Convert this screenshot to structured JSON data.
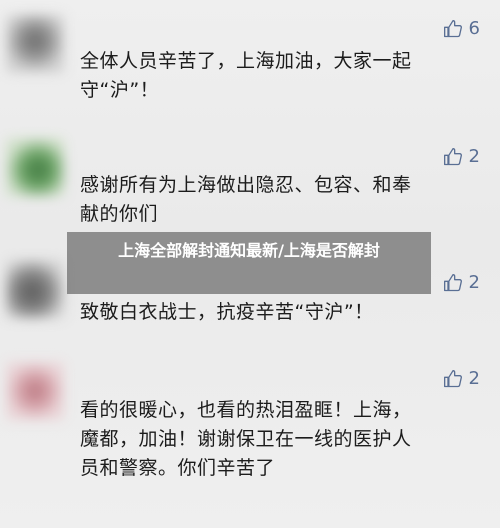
{
  "comments": [
    {
      "likes": "6",
      "text": "全体人员辛苦了，上海加油，大家一起\n守“沪”！"
    },
    {
      "likes": "2",
      "text": "感谢所有为上海做出隐忍、包容、和奉\n献的你们"
    },
    {
      "likes": "2",
      "text": "致敬白衣战士，抗疫辛苦“守沪”！"
    },
    {
      "likes": "2",
      "text": "看的很暖心，也看的热泪盈眶！上海，\n魔都，加油！谢谢保卫在一线的医护人\n员和警察。你们辛苦了"
    }
  ],
  "overlay_title": "上海全部解封通知最新/上海是否解封",
  "icons": {
    "like": "thumbs-up-icon"
  },
  "colors": {
    "like_color": "#5a6f94",
    "overlay_bg": "#737373"
  }
}
